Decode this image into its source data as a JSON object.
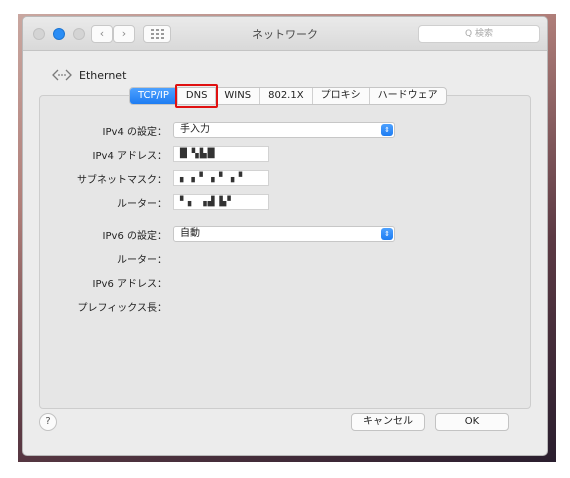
{
  "window": {
    "title": "ネットワーク",
    "search_placeholder": "Q 検索",
    "nav_back_glyph": "‹",
    "nav_fwd_glyph": "›"
  },
  "interface": {
    "name": "Ethernet",
    "icon": "ethernet-arrows-icon"
  },
  "tabs": [
    {
      "label": "TCP/IP",
      "active": true
    },
    {
      "label": "DNS",
      "active": false,
      "highlighted": true
    },
    {
      "label": "WINS",
      "active": false
    },
    {
      "label": "802.1X",
      "active": false
    },
    {
      "label": "プロキシ",
      "active": false
    },
    {
      "label": "ハードウェア",
      "active": false
    }
  ],
  "form": {
    "ipv4_config_label": "IPv4 の設定：",
    "ipv4_config_value": "手入力",
    "ipv4_address_label": "IPv4 アドレス：",
    "ipv4_address_value": "█ ▚▙█",
    "subnet_mask_label": "サブネットマスク：",
    "subnet_mask_value": "▖▗▝ ▗▝ ▗▝",
    "router_label": "ルーター：",
    "router_value": "▘▖ ▗▟ ▙▘",
    "ipv6_config_label": "IPv6 の設定：",
    "ipv6_config_value": "自動",
    "ipv6_router_label": "ルーター：",
    "ipv6_address_label": "IPv6 アドレス：",
    "prefix_length_label": "プレフィックス長："
  },
  "footer": {
    "help_label": "?",
    "cancel_label": "キャンセル",
    "ok_label": "OK"
  },
  "colors": {
    "accent": "#1d7cf2",
    "highlight_box": "#e01010"
  }
}
